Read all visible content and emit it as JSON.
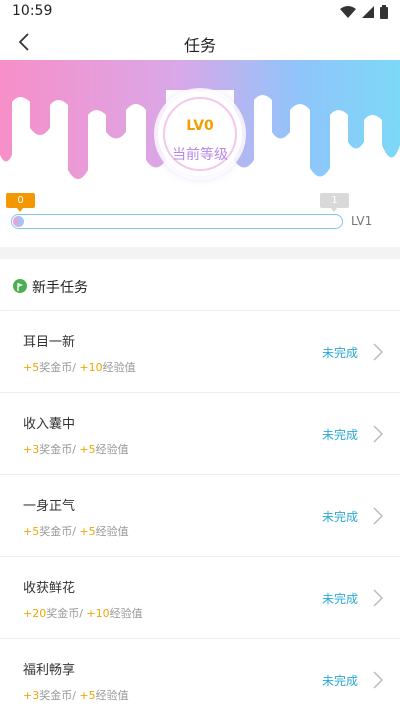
{
  "status_bar": {
    "time": "10:59"
  },
  "nav": {
    "title": "任务"
  },
  "level": {
    "current": "LV0",
    "label": "当前等级",
    "next": "LV1"
  },
  "progress": {
    "start": "0",
    "end": "1",
    "value": 0.0
  },
  "section": {
    "title": "新手任务"
  },
  "tasks": [
    {
      "title": "耳目一新",
      "coin": "5",
      "coin_label": "奖金币/ ",
      "exp": "10",
      "exp_label": "经验值",
      "status": "未完成"
    },
    {
      "title": "收入囊中",
      "coin": "3",
      "coin_label": "奖金币/ ",
      "exp": "5",
      "exp_label": "经验值",
      "status": "未完成"
    },
    {
      "title": "一身正气",
      "coin": "5",
      "coin_label": "奖金币/ ",
      "exp": "5",
      "exp_label": "经验值",
      "status": "未完成"
    },
    {
      "title": "收获鲜花",
      "coin": "20",
      "coin_label": "奖金币/ ",
      "exp": "10",
      "exp_label": "经验值",
      "status": "未完成"
    },
    {
      "title": "福利畅享",
      "coin": "3",
      "coin_label": "奖金币/ ",
      "exp": "5",
      "exp_label": "经验值",
      "status": "未完成"
    }
  ],
  "colors": {
    "accent": "#29a9d6",
    "reward": "#f0a500",
    "start_badge": "#f39800",
    "level_text": "#f0a000"
  }
}
